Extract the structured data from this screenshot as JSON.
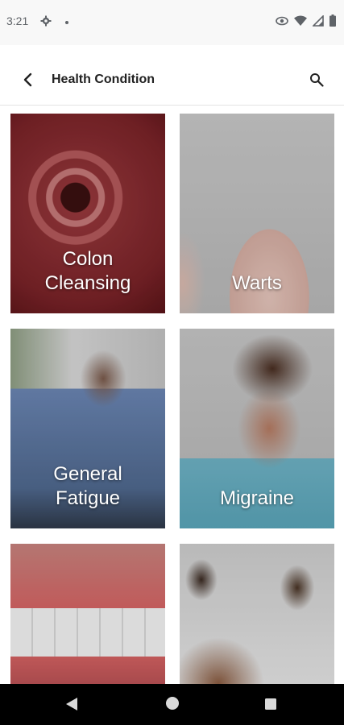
{
  "status_bar": {
    "time": "3:21",
    "left_icons": [
      "gear-icon",
      "dot-icon"
    ],
    "right_icons": [
      "eye-icon",
      "wifi-icon",
      "signal-icon",
      "battery-icon"
    ]
  },
  "app_bar": {
    "title": "Health Condition",
    "back_icon": "arrow-left-icon",
    "search_icon": "search-icon"
  },
  "conditions": [
    {
      "label": "Colon\nCleansing",
      "image": "colon-image"
    },
    {
      "label": "Warts",
      "image": "warts-image"
    },
    {
      "label": "General\nFatigue",
      "image": "fatigue-image"
    },
    {
      "label": "Migraine",
      "image": "migraine-image"
    },
    {
      "label": "",
      "image": "teeth-gum-image"
    },
    {
      "label": "",
      "image": "couple-image"
    }
  ],
  "nav_bar": {
    "icons": [
      "nav-back-icon",
      "nav-home-icon",
      "nav-recent-icon"
    ]
  },
  "colors": {
    "status_bar_bg": "#f8f8f8",
    "app_bar_bg": "#ffffff",
    "title_text": "#212121",
    "nav_bar_bg": "#000000"
  }
}
